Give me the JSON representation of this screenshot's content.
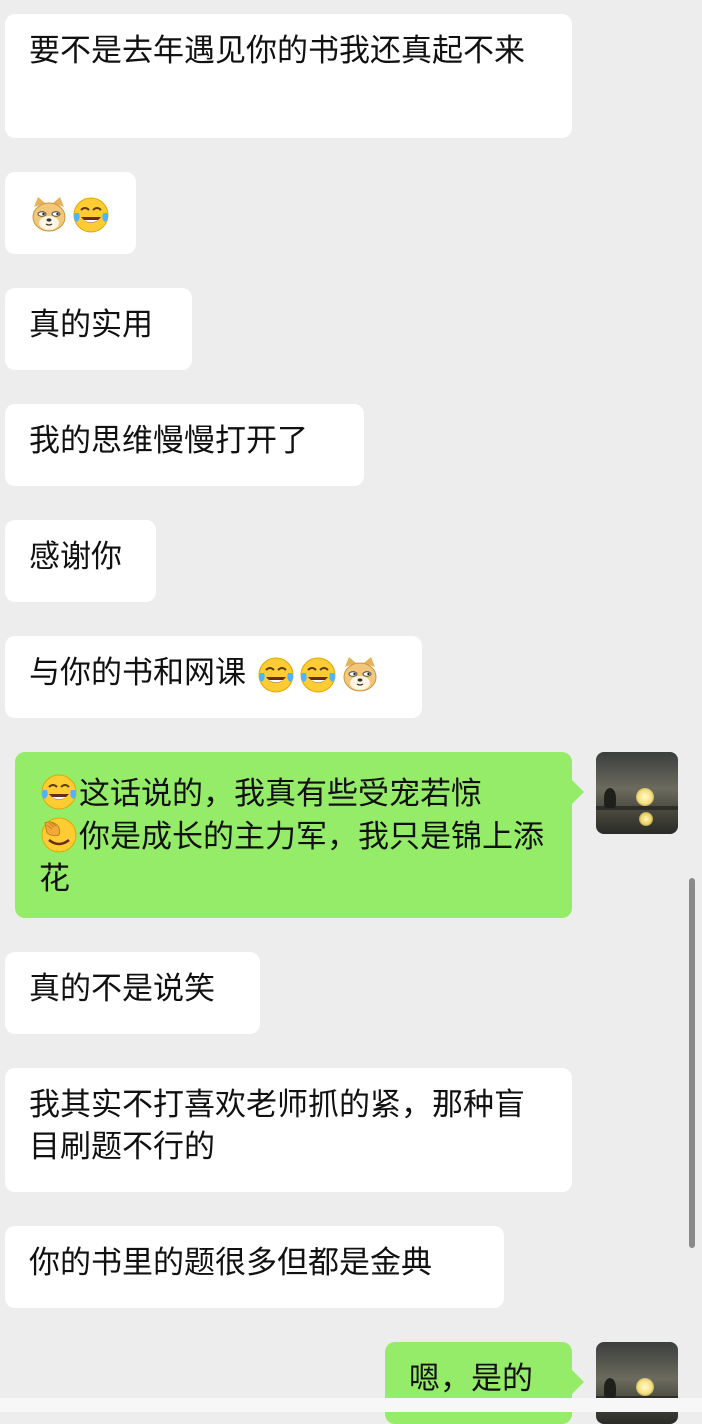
{
  "chat": {
    "messages": [
      {
        "id": 1,
        "side": "in",
        "text": "要不是去年遇见你的书我还真起不来"
      },
      {
        "id": 2,
        "side": "in",
        "text": "",
        "emojis": [
          "doge-icon",
          "tears-of-joy-icon"
        ]
      },
      {
        "id": 3,
        "side": "in",
        "text": "真的实用"
      },
      {
        "id": 4,
        "side": "in",
        "text": "我的思维慢慢打开了"
      },
      {
        "id": 5,
        "side": "in",
        "text": "感谢你"
      },
      {
        "id": 6,
        "side": "in",
        "text": "与你的书和网课",
        "emojis": [
          "tears-of-joy-icon",
          "tears-of-joy-icon",
          "doge-icon"
        ]
      },
      {
        "id": 7,
        "side": "out",
        "lines": [
          "这话说的，我真有些受宠若惊",
          "你是成长的主力军，我只是锦上添花"
        ],
        "emojis": [
          "tears-of-joy-icon",
          "facepalm-icon"
        ]
      },
      {
        "id": 8,
        "side": "in",
        "text": "真的不是说笑"
      },
      {
        "id": 9,
        "side": "in",
        "text": "我其实不打喜欢老师抓的紧，那种盲目刷题不行的"
      },
      {
        "id": 10,
        "side": "in",
        "text": "你的书里的题很多但都是金典"
      },
      {
        "id": 11,
        "side": "out",
        "text": "嗯，是的"
      }
    ]
  },
  "colors": {
    "background": "#ededed",
    "incoming_bubble": "#ffffff",
    "outgoing_bubble": "#95ec69",
    "text": "#111111"
  }
}
